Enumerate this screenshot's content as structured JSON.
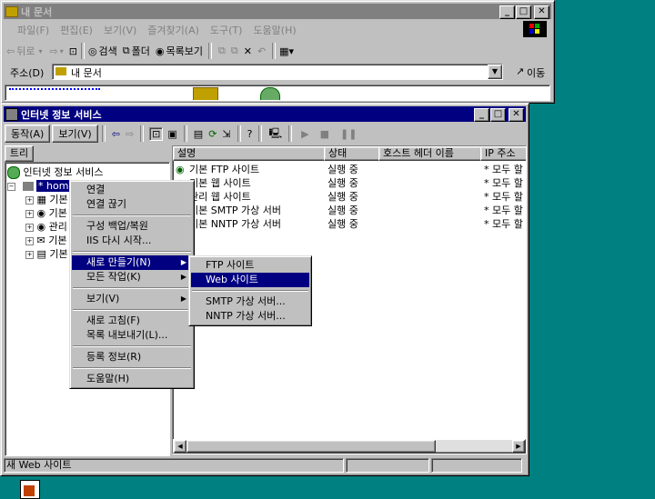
{
  "colors": {
    "desktop": "#008080",
    "title_active": "#000080",
    "title_inactive": "#808080",
    "face": "#c0c0c0"
  },
  "explorer": {
    "title": "내 문서",
    "menu": [
      "파일(F)",
      "편집(E)",
      "보기(V)",
      "즐겨찾기(A)",
      "도구(T)",
      "도움말(H)"
    ],
    "toolbar": {
      "back": "뒤로",
      "search": "검색",
      "folders": "폴더",
      "history": "목록보기"
    },
    "address_label": "주소(D)",
    "address_value": "내 문서",
    "go_label": "이동"
  },
  "iis": {
    "title": "인터넷 정보 서비스",
    "menu": [
      "동작(A)",
      "보기(V)"
    ],
    "tree_tab": "트리",
    "tree": {
      "root": "인터넷 정보 서비스",
      "server": "* home",
      "children": [
        "기본",
        "기본",
        "관리",
        "기본",
        "기본"
      ]
    },
    "columns": [
      "설명",
      "상태",
      "호스트 헤더 이름",
      "IP 주소"
    ],
    "rows": [
      {
        "desc": "기본 FTP 사이트",
        "state": "실행 중",
        "host": "",
        "ip": "* 모두 할"
      },
      {
        "desc": "기본 웹 사이트",
        "state": "실행 중",
        "host": "",
        "ip": "* 모두 할"
      },
      {
        "desc": "관리 웹 사이트",
        "state": "실행 중",
        "host": "",
        "ip": "* 모두 할"
      },
      {
        "desc": "기본 SMTP 가상 서버",
        "state": "실행 중",
        "host": "",
        "ip": "* 모두 할"
      },
      {
        "desc": "기본 NNTP 가상 서버",
        "state": "실행 중",
        "host": "",
        "ip": "* 모두 할"
      }
    ],
    "status": "새 Web 사이트"
  },
  "context_menu": {
    "items": [
      {
        "label": "연결"
      },
      {
        "label": "연결 끊기"
      },
      {
        "sep": true
      },
      {
        "label": "구성 백업/복원"
      },
      {
        "label": "IIS 다시 시작..."
      },
      {
        "sep": true
      },
      {
        "label": "새로 만들기(N)",
        "sub": true,
        "hl": true
      },
      {
        "label": "모든 작업(K)",
        "sub": true
      },
      {
        "sep": true
      },
      {
        "label": "보기(V)",
        "sub": true
      },
      {
        "sep": true
      },
      {
        "label": "새로 고침(F)"
      },
      {
        "label": "목록 내보내기(L)..."
      },
      {
        "sep": true
      },
      {
        "label": "등록 정보(R)"
      },
      {
        "sep": true
      },
      {
        "label": "도움말(H)"
      }
    ]
  },
  "submenu": {
    "items": [
      {
        "label": "FTP 사이트"
      },
      {
        "label": "Web 사이트",
        "hl": true
      },
      {
        "sep": true
      },
      {
        "label": "SMTP 가상 서버..."
      },
      {
        "label": "NNTP 가상 서버..."
      }
    ]
  }
}
